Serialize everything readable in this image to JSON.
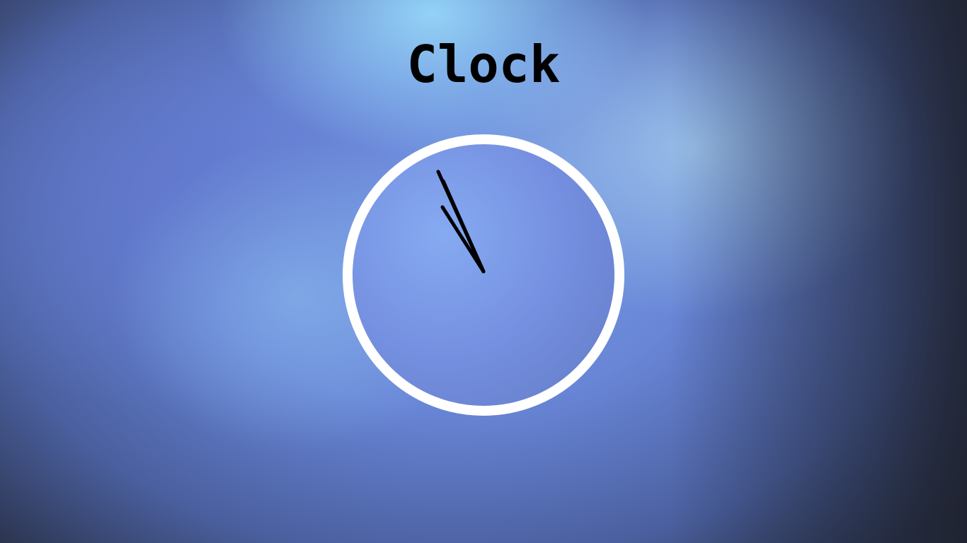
{
  "page": {
    "title": "Clock"
  },
  "clock": {
    "time": {
      "hours": 10,
      "minutes": 55,
      "seconds": 56
    },
    "face_color": "#7a9ae6",
    "ring_color": "#ffffff",
    "hand_color": "#000000"
  }
}
